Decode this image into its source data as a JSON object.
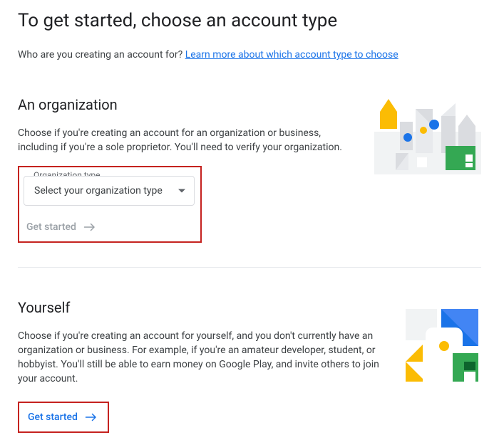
{
  "page": {
    "title": "To get started, choose an account type",
    "subtitle_prefix": "Who are you creating an account for? ",
    "learn_more_label": "Learn more about which account type to choose"
  },
  "organization": {
    "heading": "An organization",
    "description": "Choose if you're creating an account for an organization or business, including if you're a sole proprietor. You'll need to verify your organization.",
    "select_label": "Organization type",
    "select_placeholder": "Select your organization type",
    "get_started_label": "Get started"
  },
  "yourself": {
    "heading": "Yourself",
    "description": "Choose if you're creating an account for yourself, and you don't currently have an organization or business. For example, if you're an amateur developer, student, or hobbyist. You'll still be able to earn money on Google Play, and invite others to join your account.",
    "get_started_label": "Get started"
  }
}
